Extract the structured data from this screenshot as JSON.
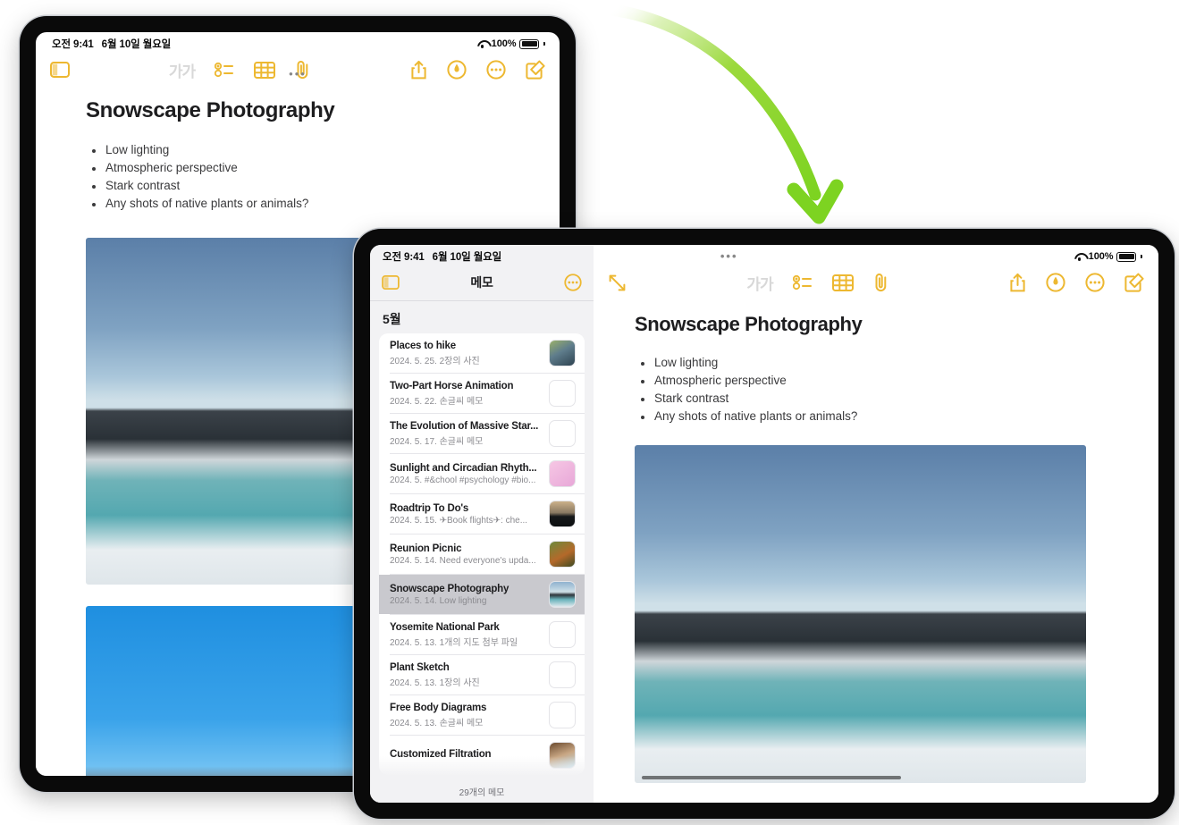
{
  "accent": {
    "toolbar_amber": "#EDB831",
    "arrow_green": "#7DD321",
    "selection_gray": "#C9C9CE"
  },
  "status_bar": {
    "time": "오전 9:41",
    "date": "6월 10일 월요일",
    "battery_percent": "100%",
    "wifi_icon": "wifi-icon",
    "battery_icon": "battery-icon"
  },
  "toolbar": {
    "sidebar_toggle_icon": "sidebar-toggle-icon",
    "expand_icon": "expand-diagonal-icon",
    "format_label": "가가",
    "checklist_icon": "checklist-icon",
    "table_icon": "table-icon",
    "attachment_icon": "paperclip-icon",
    "share_icon": "share-icon",
    "markup_icon": "markup-pen-icon",
    "more_icon": "more-ellipsis-icon",
    "compose_icon": "compose-icon",
    "multitask_dots": "•••"
  },
  "note": {
    "title": "Snowscape Photography",
    "bullets": [
      "Low lighting",
      "Atmospheric perspective",
      "Stark contrast",
      "Any shots of native plants or animals?"
    ]
  },
  "sidebar": {
    "title": "메모",
    "more_icon": "more-ellipsis-icon",
    "section_header": "5월",
    "footer_count": "29개의 메모",
    "notes": [
      {
        "title": "Places to hike",
        "meta": "2024. 5. 25.  2장의 사진",
        "thumb": "th-hike",
        "selected": false
      },
      {
        "title": "Two-Part Horse Animation",
        "meta": "2024. 5. 22.  손글씨 메모",
        "thumb": "th-blank",
        "selected": false
      },
      {
        "title": "The Evolution of Massive Star...",
        "meta": "2024. 5. 17.  손글씨 메모",
        "thumb": "th-star",
        "selected": false
      },
      {
        "title": "Sunlight and Circadian Rhyth...",
        "meta": "2024. 5. #&chool #psychology #bio...",
        "thumb": "th-pink",
        "selected": false
      },
      {
        "title": "Roadtrip To Do's",
        "meta": "2024. 5. 15.  ✈Book flights✈: che...",
        "thumb": "th-road",
        "selected": false
      },
      {
        "title": "Reunion Picnic",
        "meta": "2024. 5. 14.  Need everyone's upda...",
        "thumb": "th-picnic",
        "selected": false
      },
      {
        "title": "Snowscape Photography",
        "meta": "2024. 5. 14.  Low lighting",
        "thumb": "th-snow",
        "selected": true
      },
      {
        "title": "Yosemite National Park",
        "meta": "2024. 5. 13.  1개의 지도 첨부 파일",
        "thumb": "th-blank",
        "selected": false
      },
      {
        "title": "Plant Sketch",
        "meta": "2024. 5. 13.  1장의 사진",
        "thumb": "th-plant",
        "selected": false
      },
      {
        "title": "Free Body Diagrams",
        "meta": "2024. 5. 13.  손글씨 메모",
        "thumb": "th-fbd",
        "selected": false
      },
      {
        "title": "Customized Filtration",
        "meta": "",
        "thumb": "th-filt",
        "selected": false
      }
    ]
  },
  "annotation": {
    "arrow_name": "green-curved-arrow"
  }
}
